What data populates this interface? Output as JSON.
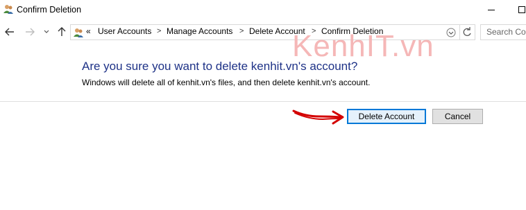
{
  "window": {
    "title": "Confirm Deletion",
    "app_icon": "user-accounts-icon"
  },
  "navigation": {
    "breadcrumbs": [
      "User Accounts",
      "Manage Accounts",
      "Delete Account",
      "Confirm Deletion"
    ],
    "overflow": "«",
    "search_placeholder": "Search Con"
  },
  "watermark": "KenhIT.vn",
  "content": {
    "heading": "Are you sure you want to delete kenhit.vn's account?",
    "description": "Windows will delete all of kenhit.vn's files, and then delete kenhit.vn's account."
  },
  "buttons": {
    "delete": "Delete Account",
    "cancel": "Cancel"
  },
  "colors": {
    "heading": "#1e3287",
    "accent": "#0078d7",
    "annotation": "#d40000"
  }
}
